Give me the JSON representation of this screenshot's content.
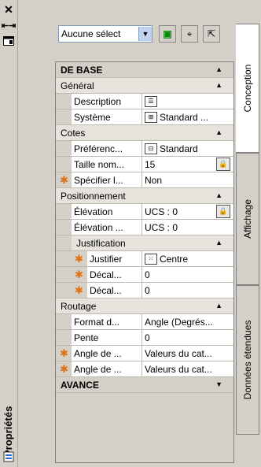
{
  "palette": {
    "title": "Propriétés",
    "close_icon": "close-icon",
    "autohide_icon": "autohide-icon",
    "menu_icon": "properties-menu-icon"
  },
  "toolbar": {
    "selection_value": "Aucune sélect",
    "buttons": [
      "select-objects-icon",
      "quick-select-icon",
      "toggle-pickadd-icon"
    ]
  },
  "tabs": [
    "Conception",
    "Affichage",
    "Données étendues"
  ],
  "sections": {
    "de_base": "DE BASE",
    "general": "Général",
    "cotes": "Cotes",
    "positionnement": "Positionnement",
    "justification": "Justification",
    "routage": "Routage",
    "avance": "AVANCE"
  },
  "props": {
    "description": {
      "name": "Description",
      "value": ""
    },
    "systeme": {
      "name": "Système",
      "value": "Standard ..."
    },
    "preference": {
      "name": "Préférenc...",
      "value": "Standard"
    },
    "taille": {
      "name": "Taille nom...",
      "value": "15"
    },
    "specifier": {
      "name": "Spécifier l...",
      "value": "Non"
    },
    "elevation": {
      "name": "Élévation",
      "value": "UCS : 0"
    },
    "elevation2": {
      "name": "Élévation ...",
      "value": "UCS : 0"
    },
    "justifier": {
      "name": "Justifier",
      "value": "Centre"
    },
    "decal1": {
      "name": "Décal...",
      "value": "0"
    },
    "decal2": {
      "name": "Décal...",
      "value": "0"
    },
    "format": {
      "name": "Format d...",
      "value": "Angle (Degrés..."
    },
    "pente": {
      "name": "Pente",
      "value": "0"
    },
    "angle1": {
      "name": "Angle de ...",
      "value": "Valeurs du cat..."
    },
    "angle2": {
      "name": "Angle de ...",
      "value": "Valeurs du cat..."
    }
  },
  "colors": {
    "accent_star": "#e07010"
  }
}
